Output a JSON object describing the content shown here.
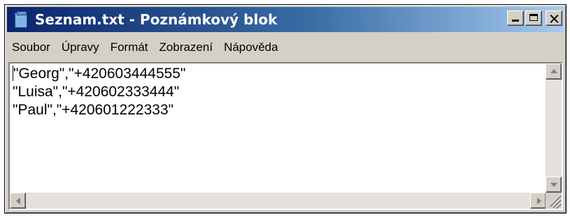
{
  "window": {
    "title": "Seznam.txt - Poznámkový blok"
  },
  "title_buttons": [
    "minimize",
    "maximize",
    "close"
  ],
  "menu": [
    "Soubor",
    "Úpravy",
    "Formát",
    "Zobrazení",
    "Nápověda"
  ],
  "document": {
    "lines": [
      "\"Georg\",\"+420603444555\"",
      "\"Luisa\",\"+420602333444\"",
      "\"Paul\",\"+420601222333\""
    ]
  },
  "icons": {
    "app": "notepad-icon",
    "minimize": "minimize-icon",
    "maximize": "maximize-icon",
    "close": "close-icon"
  },
  "colors": {
    "titlebar_start": "#0a246a",
    "titlebar_end": "#a6caf0",
    "window_face": "#d4d0c8",
    "editor_background": "#ffffff"
  }
}
